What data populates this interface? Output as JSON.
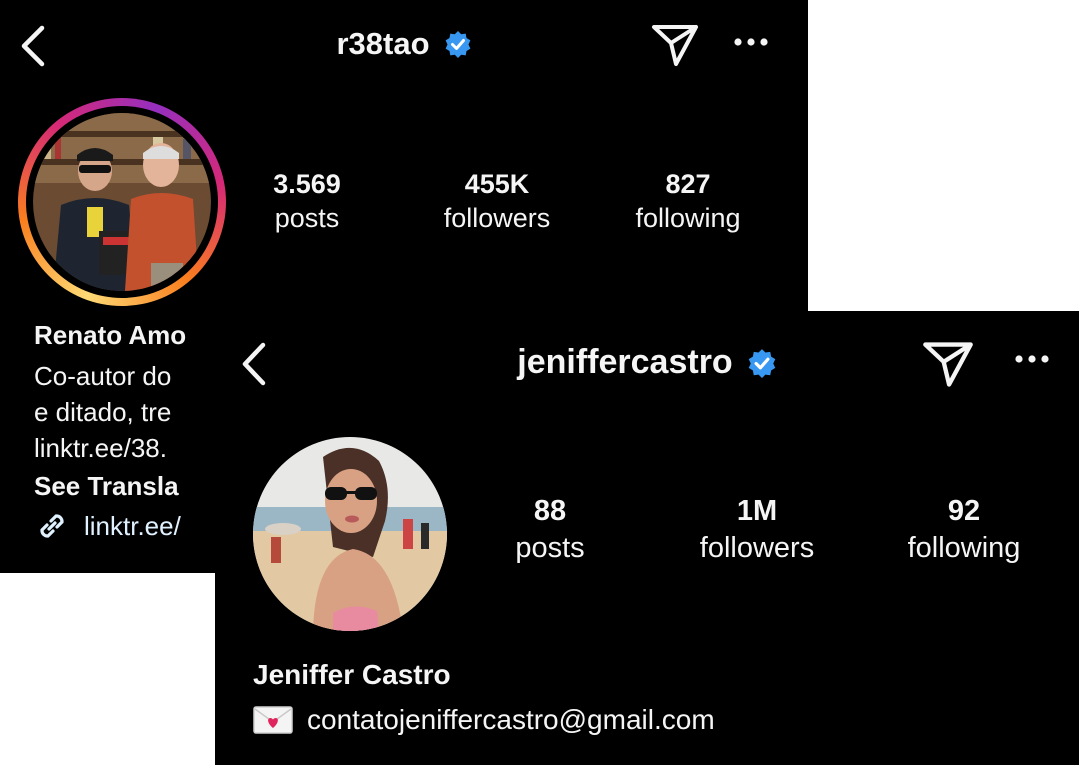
{
  "back_profile": {
    "username": "r38tao",
    "stats": [
      {
        "value": "3.569",
        "label": "posts"
      },
      {
        "value": "455K",
        "label": "followers"
      },
      {
        "value": "827",
        "label": "following"
      }
    ],
    "display_name": "Renato Amo",
    "bio_lines": [
      "Co-autor do",
      "e ditado, tre",
      "linktr.ee/38."
    ],
    "see_translation": "See Transla",
    "link": "linktr.ee/"
  },
  "front_profile": {
    "username": "jeniffercastro",
    "stats": [
      {
        "value": "88",
        "label": "posts"
      },
      {
        "value": "1M",
        "label": "followers"
      },
      {
        "value": "92",
        "label": "following"
      }
    ],
    "display_name": "Jeniffer Castro",
    "email": "contatojeniffercastro@gmail.com",
    "email_icon": "love-letter-icon"
  },
  "colors": {
    "background": "#000000",
    "text": "#f5f5f5",
    "verified_badge": "#3897f0",
    "story_ring": [
      "#feda75",
      "#fa7e1e",
      "#d62976",
      "#962fbf"
    ]
  }
}
